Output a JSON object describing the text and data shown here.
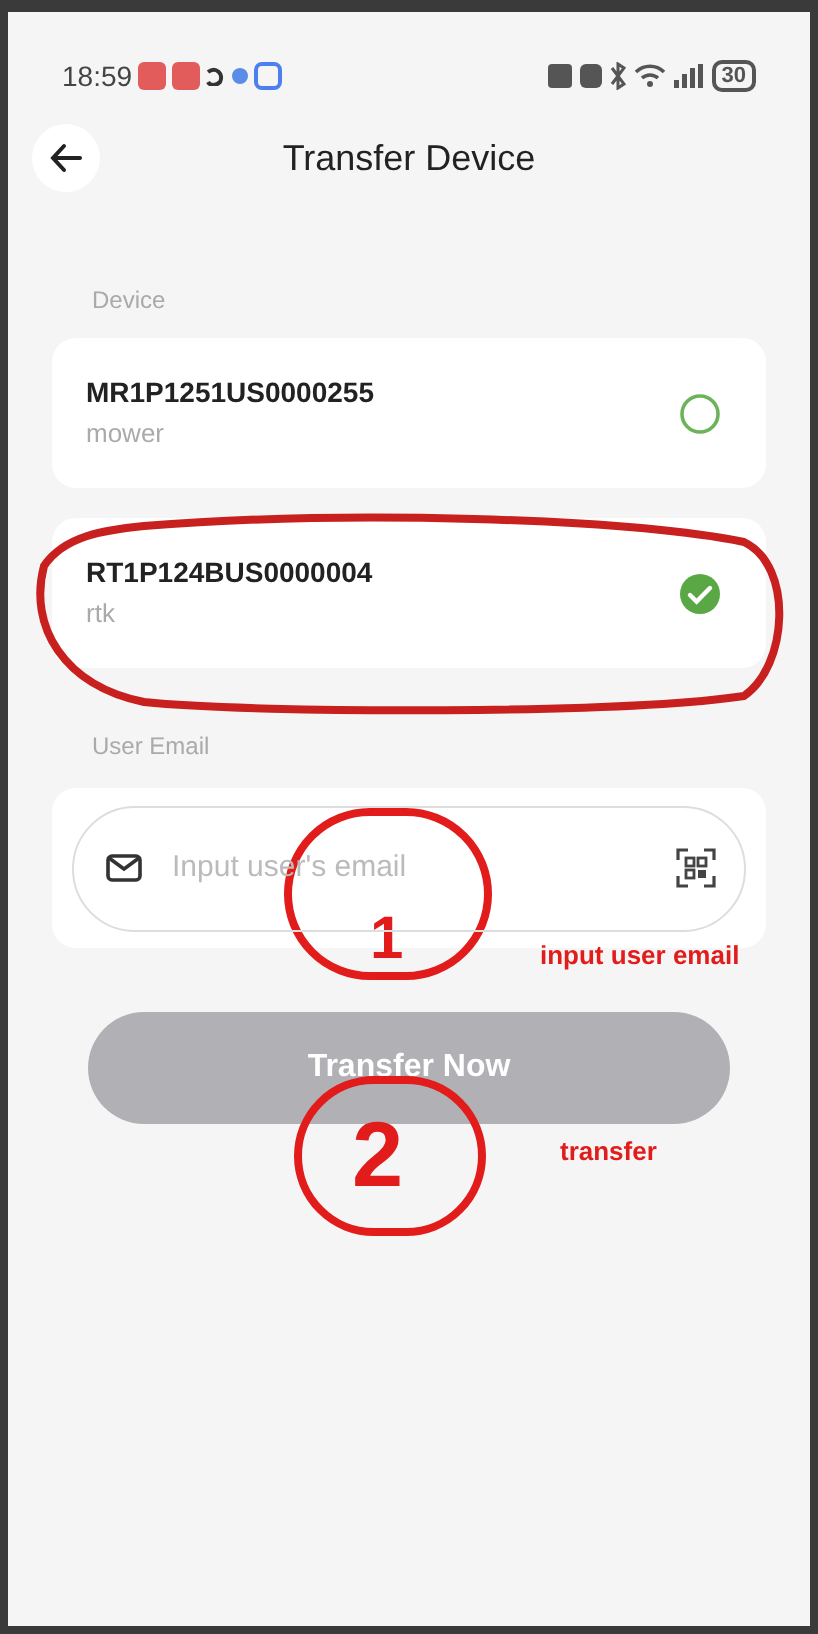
{
  "status_bar": {
    "time": "18:59",
    "battery": "30"
  },
  "header": {
    "title": "Transfer Device"
  },
  "device_section": {
    "label": "Device",
    "devices": [
      {
        "serial": "MR1P1251US0000255",
        "type": "mower",
        "selected": false
      },
      {
        "serial": "RT1P124BUS0000004",
        "type": "rtk",
        "selected": true
      }
    ]
  },
  "email_section": {
    "label": "User Email",
    "placeholder": "Input user's email"
  },
  "transfer_button": {
    "label": "Transfer Now",
    "disabled": true
  },
  "annotations": [
    {
      "number": "1",
      "note": "input user email"
    },
    {
      "number": "2",
      "note": "transfer"
    }
  ]
}
